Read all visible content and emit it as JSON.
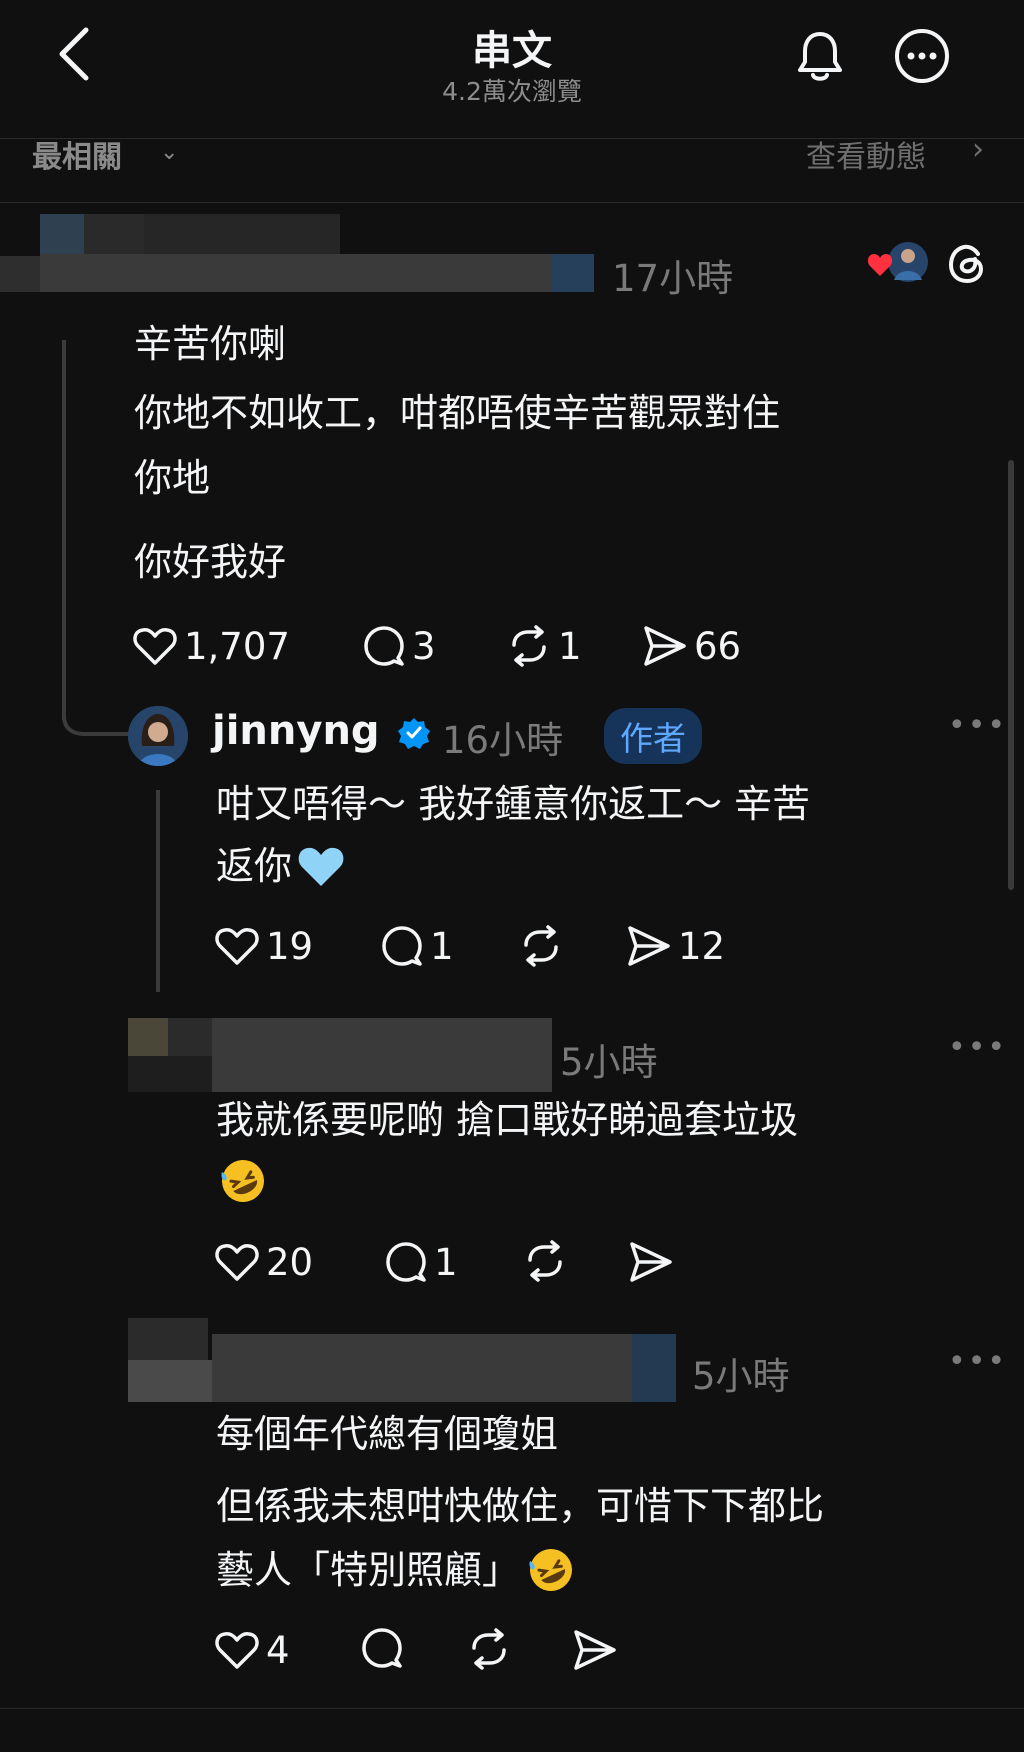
{
  "header": {
    "title": "串文",
    "subtitle": "4.2萬次瀏覽",
    "icons": [
      "back-icon",
      "bell-icon",
      "more-icon"
    ]
  },
  "sortbar": {
    "label": "最相關",
    "activity": "查看動態"
  },
  "comments": [
    {
      "time": "17小時",
      "lines": [
        "辛苦你喇",
        "你地不如收工，咁都唔使辛苦觀眾對住",
        "你地",
        "你好我好"
      ],
      "likes": "1,707",
      "replies": "3",
      "reposts": "1",
      "shares": "66"
    },
    {
      "author": "jinnyng",
      "time": "16小時",
      "badge": "作者",
      "lines": [
        "咁又唔得～ 我好鍾意你返工～ 辛苦",
        "返你"
      ],
      "likes": "19",
      "replies": "1",
      "reposts": "",
      "shares": "12"
    },
    {
      "time": "5小時",
      "lines": [
        "我就係要呢啲 搶口戰好睇過套垃圾"
      ],
      "likes": "20",
      "replies": "1",
      "reposts": "",
      "shares": ""
    },
    {
      "time": "5小時",
      "lines": [
        "每個年代總有個瓊姐",
        "但係我未想咁快做住，可惜下下都比",
        "藝人「特別照顧」"
      ],
      "likes": "4",
      "replies": "",
      "reposts": "",
      "shares": ""
    }
  ],
  "colors": {
    "background": "#101010",
    "text": "#f3f5f7",
    "muted": "#7a7a7a",
    "verified": "#0095f6",
    "heart": "#ff3040",
    "badge_text": "#5fa8ff"
  },
  "emoji": {
    "blue_heart": "blue-heart-icon",
    "rofl": "rofl-icon"
  }
}
